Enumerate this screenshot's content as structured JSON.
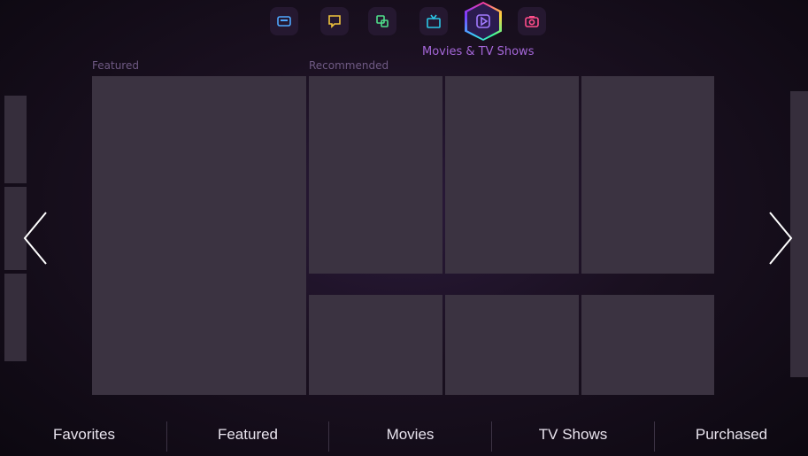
{
  "header": {
    "active_app_title": "Movies & TV Shows",
    "apps": [
      {
        "icon": "info-icon",
        "color": "#4fa8ff"
      },
      {
        "icon": "chat-icon",
        "color": "#f0c43c"
      },
      {
        "icon": "multi-screen-icon",
        "color": "#4fe08a"
      },
      {
        "icon": "tv-icon",
        "color": "#2cc8e8"
      },
      {
        "icon": "play-icon",
        "color": "#a27bff"
      },
      {
        "icon": "camera-icon",
        "color": "#ff4d8a"
      }
    ]
  },
  "sections": {
    "featured": "Featured",
    "recommended": "Recommended"
  },
  "bottom_nav": [
    "Favorites",
    "Featured",
    "Movies",
    "TV Shows",
    "Purchased"
  ],
  "colors": {
    "tile": "#3b3341",
    "active_title": "#a466d8",
    "nav_text": "#e9e4ee"
  }
}
